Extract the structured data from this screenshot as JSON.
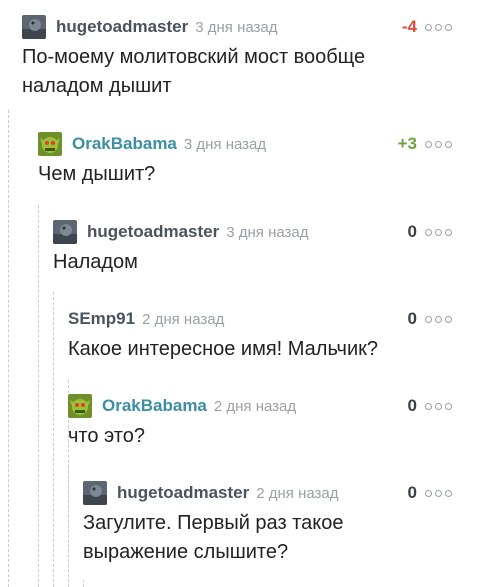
{
  "comments": [
    {
      "author": "hugetoadmaster",
      "time": "3 дня назад",
      "rating": "-4",
      "text_lines": [
        "По-моему молитовский мост вообще",
        "наладом дышит"
      ],
      "avatar": "toad-avatar"
    },
    {
      "author": "OrakBabama",
      "time": "3 дня назад",
      "rating": "+3",
      "text_lines": [
        "Чем дышит?"
      ],
      "avatar": "orc-avatar"
    },
    {
      "author": "hugetoadmaster",
      "time": "3 дня назад",
      "rating": "0",
      "text_lines": [
        "Наладом"
      ],
      "avatar": "toad-avatar"
    },
    {
      "author": "SEmp91",
      "time": "2 дня назад",
      "rating": "0",
      "text_lines": [
        "Какое интересное имя! Мальчик?"
      ],
      "avatar": ""
    },
    {
      "author": "OrakBabama",
      "time": "2 дня назад",
      "rating": "0",
      "text_lines": [
        "что это?"
      ],
      "avatar": "orc-avatar"
    },
    {
      "author": "hugetoadmaster",
      "time": "2 дня назад",
      "rating": "0",
      "text_lines": [
        "Загулите. Первый раз такое",
        "выражение слышите?"
      ],
      "avatar": "toad-avatar"
    }
  ],
  "colors": {
    "negative": "#dd4b39",
    "positive": "#6aa33c",
    "author_link": "#3c8ea5",
    "author": "#4a5360"
  },
  "icons": {
    "menu": "more-options-icon"
  }
}
